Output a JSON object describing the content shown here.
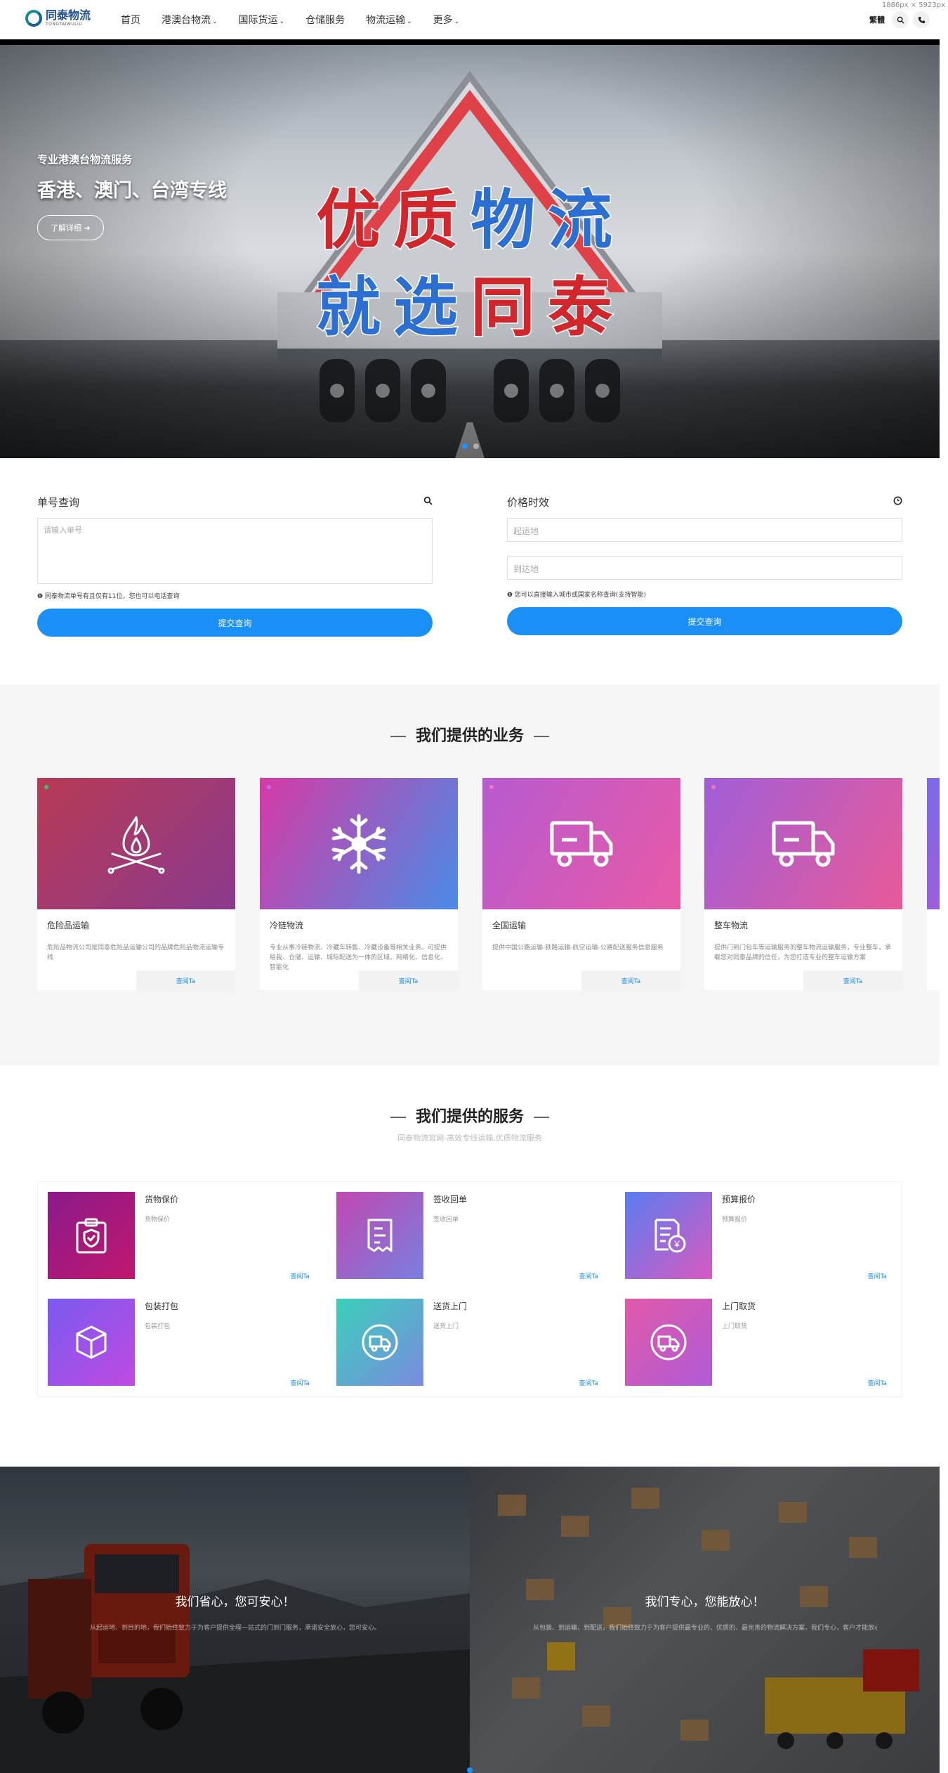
{
  "meta": {
    "dimension_note": "1886px × 5923px"
  },
  "header": {
    "logo_cn": "同泰物流",
    "logo_en": "TONGTAIWULIU",
    "nav": [
      {
        "label": "首页",
        "dropdown": false
      },
      {
        "label": "港澳台物流",
        "dropdown": true
      },
      {
        "label": "国际货运",
        "dropdown": true
      },
      {
        "label": "仓储服务",
        "dropdown": false
      },
      {
        "label": "物流运输",
        "dropdown": true
      },
      {
        "label": "更多",
        "dropdown": true
      }
    ],
    "lang": "繁體",
    "icons": [
      "search-icon",
      "phone-icon"
    ]
  },
  "hero": {
    "subtitle": "专业港澳台物流服务",
    "title": "香港、澳门、台湾专线",
    "button_label": "了解详细 ➜",
    "slogan_line1": [
      "优",
      "质",
      "物",
      "流"
    ],
    "slogan_line2": [
      "就",
      "选",
      "同",
      "泰"
    ],
    "slogan_colors": {
      "red": "#d2262d",
      "blue": "#2b6fd2"
    },
    "active_slide": 1,
    "slide_count": 2
  },
  "query": {
    "left": {
      "title": "单号查询",
      "icon": "search-icon",
      "placeholder": "请输入单号",
      "note": "❶ 同泰物流单号有且仅有11位，您也可以电话查询",
      "button": "提交查询"
    },
    "right": {
      "title": "价格时效",
      "icon": "clock-icon",
      "from_placeholder": "起运地",
      "to_placeholder": "到达地",
      "note": "❶ 您可以直接输入城市或国家名称查询(支持智能)",
      "button": "提交查询"
    }
  },
  "business": {
    "title": "我们提供的业务",
    "cards": [
      {
        "name": "危险品运输",
        "desc": "危险品物流公司是同泰危险品运输公司的品牌危险品物流运输专线",
        "more": "查阅Ta",
        "icon": "fire-icon",
        "grad": [
          "#b83a55",
          "#8a3a8e"
        ]
      },
      {
        "name": "冷链物流",
        "desc": "专业从事冷链物流、冷藏车转售、冷藏设备等相关业务。可提供给我、仓储、运输、城际配送为一体的区域、网络化、信息化、智能化",
        "more": "查阅Ta",
        "icon": "snowflake-icon",
        "grad": [
          "#d63aa5",
          "#4a8be6"
        ]
      },
      {
        "name": "全国运输",
        "desc": "提供中国公路运输-铁路运输-航空运输-公路配送服务信息服务",
        "more": "查阅Ta",
        "icon": "truck-icon",
        "grad": [
          "#b75ad0",
          "#e85aa6"
        ]
      },
      {
        "name": "整车物流",
        "desc": "提供门到门包车等运输服务的整车物流运输服务，专业整车，承载您对同泰品牌的信任，为您打造专业的整车运输方案",
        "more": "查阅Ta",
        "icon": "truck-icon",
        "grad": [
          "#a05ed8",
          "#e85a98"
        ]
      }
    ]
  },
  "services": {
    "title": "我们提供的服务",
    "subtitle": "同泰物流官网-高效专线运输,优质物流服务",
    "items": [
      {
        "name": "货物保价",
        "desc": "货物保价",
        "more": "查阅Ta",
        "icon": "shield-icon",
        "grad": [
          "#8a1a8a",
          "#c0186e"
        ]
      },
      {
        "name": "签收回单",
        "desc": "签收回单",
        "more": "查阅Ta",
        "icon": "receipt-icon",
        "grad": [
          "#c048b0",
          "#7a7fe0"
        ]
      },
      {
        "name": "预算报价",
        "desc": "预算报价",
        "more": "查阅Ta",
        "icon": "quote-icon",
        "grad": [
          "#5a7cf0",
          "#d85ac0"
        ]
      },
      {
        "name": "包装打包",
        "desc": "包装打包",
        "more": "查阅Ta",
        "icon": "box-icon",
        "grad": [
          "#7a5af0",
          "#c04ae0"
        ]
      },
      {
        "name": "送货上门",
        "desc": "送货上门",
        "more": "查阅Ta",
        "icon": "delivery-icon",
        "grad": [
          "#3ad0b8",
          "#7a8ae0"
        ]
      },
      {
        "name": "上门取货",
        "desc": "上门取货",
        "more": "查阅Ta",
        "icon": "pickup-icon",
        "grad": [
          "#e05aa8",
          "#b05ad8"
        ]
      }
    ]
  },
  "banners": {
    "left": {
      "title": "我们省心，您可安心！",
      "desc": "从起运地、到目的地，我们始终致力于为客户提供全程一站式的门到门服务，承诺安全放心，您可安心。"
    },
    "right": {
      "title": "我们专心，您能放心！",
      "desc": "从包装、到运输、到配送，我们始终致力于为客户提供最专业的、优质的、最完善的物流解决方案，我们专心，客户才能放心。"
    }
  }
}
